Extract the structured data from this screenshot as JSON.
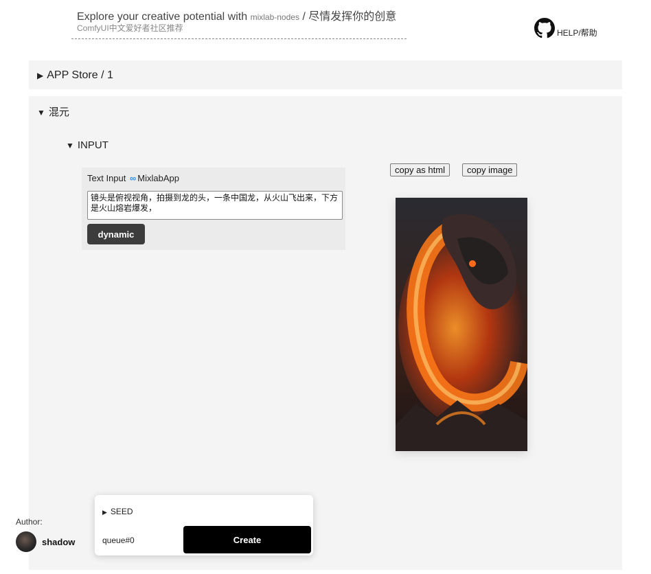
{
  "header": {
    "tagline_prefix": "Explore your creative potential with",
    "tagline_brand": "mixlab-nodes",
    "tagline_suffix": "/ 尽情发挥你的创意",
    "subtitle": "ComfyUI中文爱好者社区推荐",
    "help_label": "HELP/帮助",
    "help_icon": "github-icon"
  },
  "app_store": {
    "label": "APP Store / 1"
  },
  "section": {
    "title": "混元",
    "input_title": "INPUT",
    "text_input": {
      "title": "Text Input",
      "infinity": "∞",
      "app_name": "MixlabApp",
      "value": "镜头是俯视视角，拍摄到龙的头，一条中国龙，从火山飞出来，下方是火山熔岩爆发，",
      "dynamic_label": "dynamic"
    },
    "output": {
      "copy_html_label": "copy as html",
      "copy_image_label": "copy image"
    }
  },
  "author": {
    "label": "Author:",
    "name": "shadow"
  },
  "run_panel": {
    "seed_label": "SEED",
    "queue_label": "queue#0",
    "create_label": "Create"
  },
  "colors": {
    "accent_infinity": "#2a8ff2",
    "create_button": "#000000",
    "dynamic_button": "#3c3c3c"
  }
}
